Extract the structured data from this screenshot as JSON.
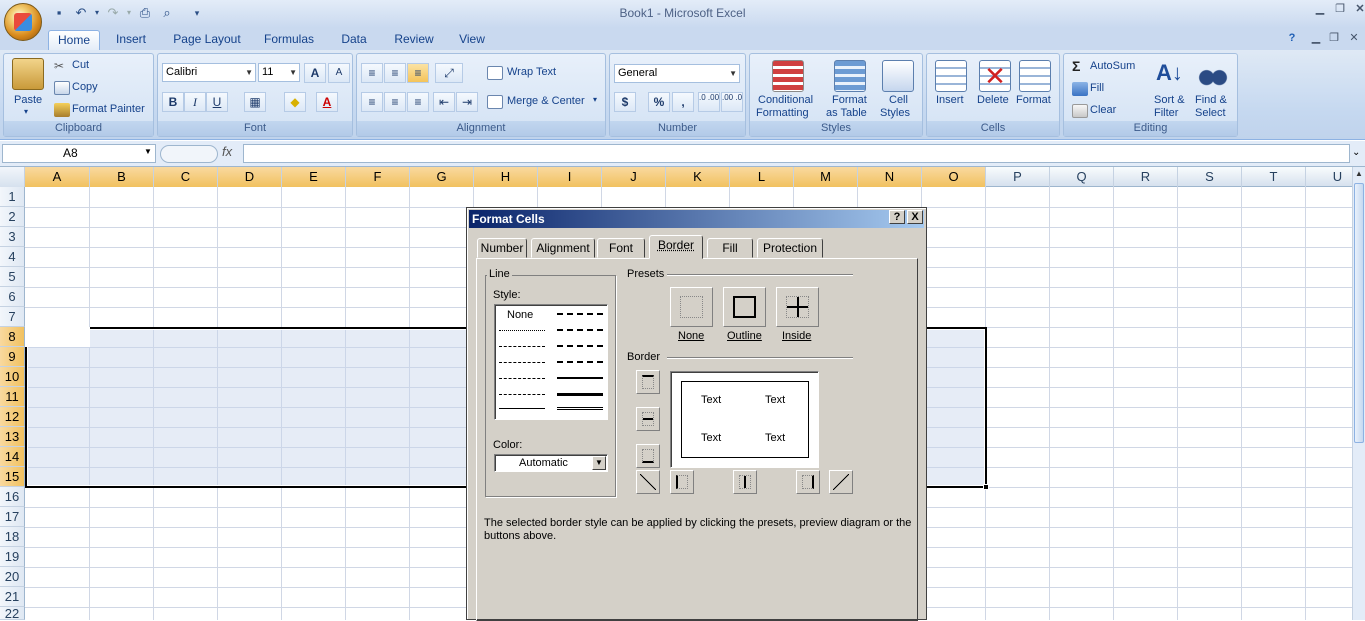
{
  "app": {
    "title": "Book1 - Microsoft Excel"
  },
  "ribbon_tabs": [
    "Home",
    "Insert",
    "Page Layout",
    "Formulas",
    "Data",
    "Review",
    "View"
  ],
  "clipboard": {
    "paste": "Paste",
    "cut": "Cut",
    "copy": "Copy",
    "format_painter": "Format Painter",
    "label": "Clipboard"
  },
  "font": {
    "name": "Calibri",
    "size": "11",
    "label": "Font",
    "bold": "B",
    "italic": "I",
    "underline": "U",
    "grow": "A",
    "shrink": "A",
    "font_color": "A"
  },
  "alignment": {
    "wrap_text": "Wrap Text",
    "merge_center": "Merge & Center",
    "label": "Alignment"
  },
  "number": {
    "format": "General",
    "currency": "$",
    "percent": "%",
    "comma": ",",
    "inc_dec": ".0 .00",
    "dec_dec": ".00 .0",
    "label": "Number"
  },
  "styles": {
    "conditional": "Conditional",
    "conditional2": "Formatting",
    "format_as": "Format",
    "format_as2": "as Table",
    "cell": "Cell",
    "cell2": "Styles",
    "label": "Styles"
  },
  "cells": {
    "insert": "Insert",
    "delete": "Delete",
    "format": "Format",
    "label": "Cells"
  },
  "editing": {
    "autosum": "AutoSum",
    "fill": "Fill",
    "clear": "Clear",
    "sort": "Sort &",
    "sort2": "Filter",
    "find": "Find &",
    "find2": "Select",
    "label": "Editing",
    "sigma": "Σ"
  },
  "formula_bar": {
    "name_box": "A8",
    "fx": "fx",
    "value": ""
  },
  "columns": [
    "A",
    "B",
    "C",
    "D",
    "E",
    "F",
    "G",
    "H",
    "I",
    "J",
    "K",
    "L",
    "M",
    "N",
    "O",
    "P",
    "Q",
    "R",
    "S",
    "T",
    "U"
  ],
  "rows": [
    "1",
    "2",
    "3",
    "4",
    "5",
    "6",
    "7",
    "8",
    "9",
    "10",
    "11",
    "12",
    "13",
    "14",
    "15",
    "16",
    "17",
    "18",
    "19",
    "20",
    "21",
    "22"
  ],
  "dialog": {
    "title": "Format Cells",
    "help": "?",
    "close": "X",
    "tabs": [
      "Number",
      "Alignment",
      "Font",
      "Border",
      "Fill",
      "Protection"
    ],
    "active_tab": "Border",
    "line_group": "Line",
    "style_label": "Style:",
    "none_style": "None",
    "color_label": "Color:",
    "color_value": "Automatic",
    "presets_label": "Presets",
    "preset_none": "None",
    "preset_outline": "Outline",
    "preset_inside": "Inside",
    "border_label": "Border",
    "preview_text": [
      "Text",
      "Text",
      "Text",
      "Text"
    ],
    "hint": "The selected border style can be applied by clicking the presets, preview diagram or the buttons above."
  }
}
